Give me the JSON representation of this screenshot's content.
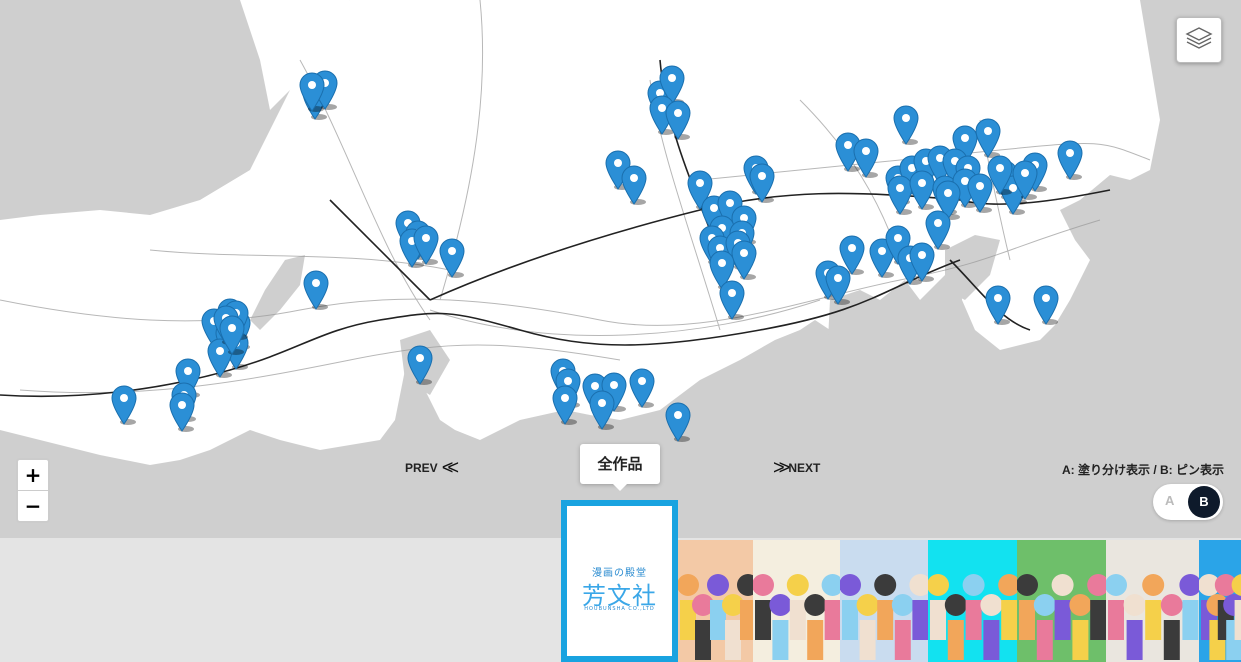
{
  "map": {
    "land_color": "#ffffff",
    "water_color": "#cfcfcf",
    "pin_color": "#2b8fd6",
    "pin_count": 95
  },
  "controls": {
    "layers_icon": "layers-icon",
    "zoom_in_label": "+",
    "zoom_out_label": "−",
    "prev_label": "PREV",
    "prev_icon": "<<",
    "next_label": "NEXT",
    "next_icon": ">>",
    "mode_label": "A: 塗り分け表示 / B: ピン表示",
    "mode_a": "A",
    "mode_b": "B",
    "mode_selected": "B"
  },
  "carousel": {
    "selected_label": "全作品",
    "logo": {
      "small_text": "漫画の殿堂",
      "main_text": "芳文社",
      "corp_text": "HOUBUNSHA CO.,LTD"
    },
    "covers": [
      {
        "name": "cover-1",
        "bg": "#f3c9a6"
      },
      {
        "name": "cover-2",
        "bg": "#f4eedf"
      },
      {
        "name": "cover-3",
        "bg": "#c9dcef"
      },
      {
        "name": "cover-4",
        "bg": "#12e2f0"
      },
      {
        "name": "cover-5",
        "bg": "#6ebf6a"
      },
      {
        "name": "cover-6",
        "bg": "#eae6df"
      },
      {
        "name": "cover-7",
        "bg": "#2aa4e8"
      }
    ]
  }
}
